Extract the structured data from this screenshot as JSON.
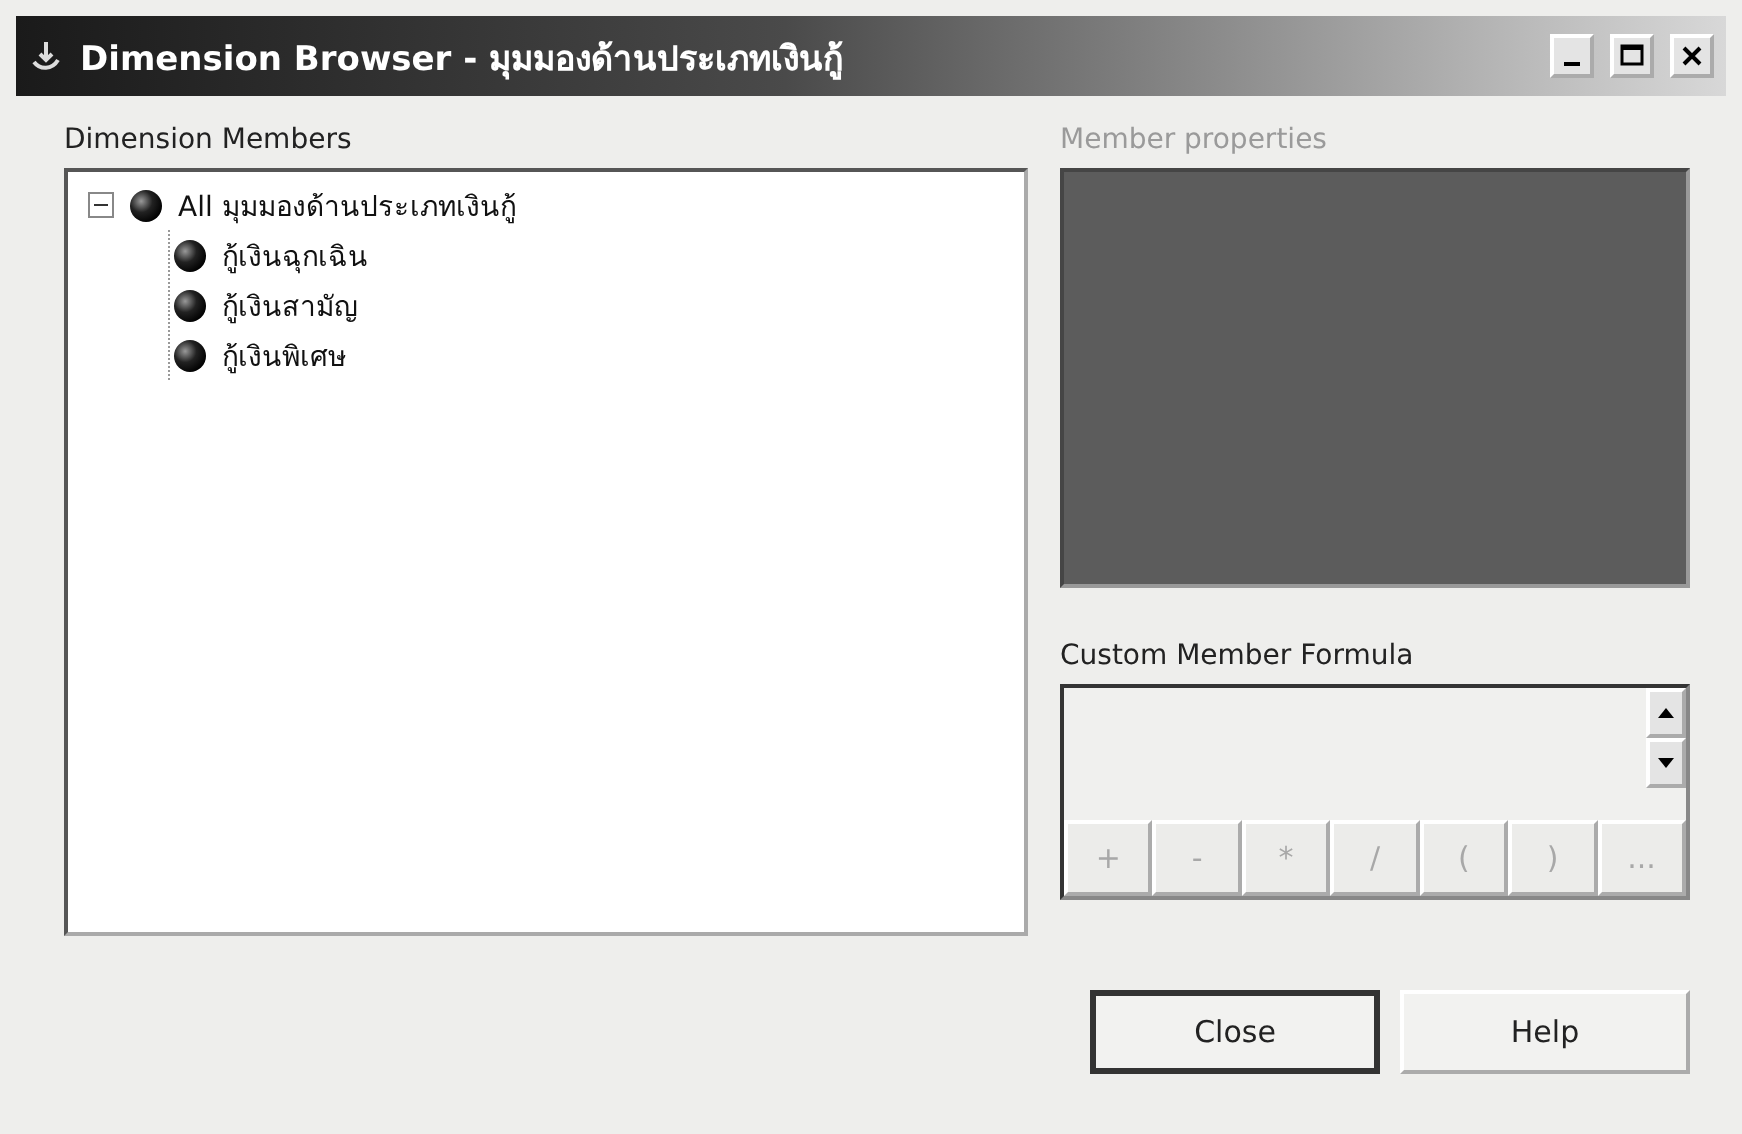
{
  "window": {
    "title": "Dimension Browser - มุมมองด้านประเภทเงินกู้"
  },
  "dimension_members": {
    "label": "Dimension Members",
    "tree": [
      {
        "label": "All มุมมองด้านประเภทเงินกู้",
        "expanded": true,
        "children": [
          {
            "label": "กู้เงินฉุกเฉิน"
          },
          {
            "label": "กู้เงินสามัญ"
          },
          {
            "label": "กู้เงินพิเศษ"
          }
        ]
      }
    ]
  },
  "member_properties": {
    "label": "Member properties",
    "disabled": true
  },
  "custom_member_formula": {
    "label": "Custom Member Formula",
    "operators": [
      {
        "label": "+",
        "disabled": true
      },
      {
        "label": "-",
        "disabled": true
      },
      {
        "label": "*",
        "disabled": true
      },
      {
        "label": "/",
        "disabled": true
      },
      {
        "label": "(",
        "disabled": true
      },
      {
        "label": ")",
        "disabled": true
      },
      {
        "label": "...",
        "disabled": true
      }
    ]
  },
  "buttons": [
    {
      "label": "Close",
      "default": true
    },
    {
      "label": "Help",
      "default": false
    }
  ]
}
